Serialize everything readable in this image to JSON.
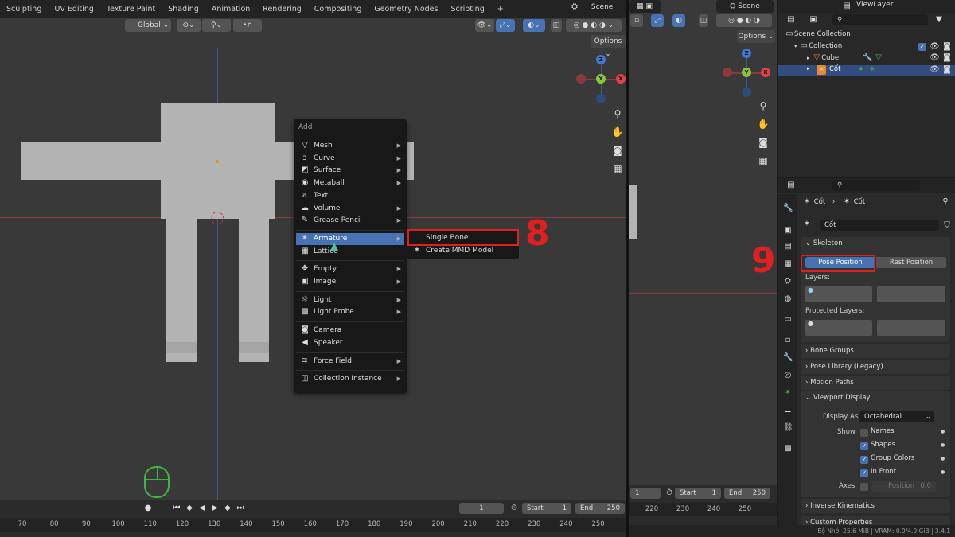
{
  "workspace_tabs": [
    "Sculpting",
    "UV Editing",
    "Texture Paint",
    "Shading",
    "Animation",
    "Rendering",
    "Compositing",
    "Geometry Nodes",
    "Scripting",
    "+"
  ],
  "scene_name": "Scene",
  "view_layer": "ViewLayer",
  "transform_orientation": "Global",
  "options_label": "Options",
  "add_menu": {
    "title": "Add",
    "items": [
      {
        "label": "Mesh",
        "icon": "mesh-icon",
        "glyph": "▽",
        "has_sub": true
      },
      {
        "label": "Curve",
        "icon": "curve-icon",
        "glyph": "ↄ",
        "has_sub": true
      },
      {
        "label": "Surface",
        "icon": "surface-icon",
        "glyph": "◩",
        "has_sub": true
      },
      {
        "label": "Metaball",
        "icon": "metaball-icon",
        "glyph": "◉",
        "has_sub": true
      },
      {
        "label": "Text",
        "icon": "text-icon",
        "glyph": "a",
        "has_sub": false
      },
      {
        "label": "Volume",
        "icon": "volume-icon",
        "glyph": "☁",
        "has_sub": true
      },
      {
        "label": "Grease Pencil",
        "icon": "grease-pencil-icon",
        "glyph": "✎",
        "has_sub": true
      },
      {
        "label": "Armature",
        "icon": "armature-icon",
        "glyph": "✶",
        "has_sub": true,
        "active": true
      },
      {
        "label": "Lattice",
        "icon": "lattice-icon",
        "glyph": "▦",
        "has_sub": false
      },
      {
        "label": "Empty",
        "icon": "empty-icon",
        "glyph": "✥",
        "has_sub": true
      },
      {
        "label": "Image",
        "icon": "image-icon",
        "glyph": "▣",
        "has_sub": true
      },
      {
        "label": "Light",
        "icon": "light-icon",
        "glyph": "☼",
        "has_sub": true
      },
      {
        "label": "Light Probe",
        "icon": "light-probe-icon",
        "glyph": "▩",
        "has_sub": true
      },
      {
        "label": "Camera",
        "icon": "camera-icon",
        "glyph": "◙",
        "has_sub": false
      },
      {
        "label": "Speaker",
        "icon": "speaker-icon",
        "glyph": "◀",
        "has_sub": false
      },
      {
        "label": "Force Field",
        "icon": "force-field-icon",
        "glyph": "≋",
        "has_sub": true
      },
      {
        "label": "Collection Instance",
        "icon": "collection-instance-icon",
        "glyph": "◫",
        "has_sub": true
      }
    ]
  },
  "armature_submenu": [
    "Single Bone",
    "Create MMD Model"
  ],
  "step_labels": {
    "left": "8",
    "right": "9"
  },
  "timeline": {
    "current_frame": "1",
    "start_label": "Start",
    "start": "1",
    "end_label": "End",
    "end": "250",
    "ruler": [
      "70",
      "80",
      "90",
      "100",
      "110",
      "120",
      "130",
      "140",
      "150",
      "160",
      "170",
      "180",
      "190",
      "200",
      "210",
      "220",
      "230",
      "240",
      "250"
    ],
    "ruler_right": [
      "220",
      "230",
      "240",
      "250"
    ]
  },
  "outliner": {
    "scene_collection": "Scene Collection",
    "collection": "Collection",
    "objects": [
      "Cube",
      "Cốt"
    ]
  },
  "properties": {
    "breadcrumb_object": "Cốt",
    "breadcrumb_data": "Cốt",
    "data_name": "Cốt",
    "skeleton_label": "Skeleton",
    "pose_position": "Pose Position",
    "rest_position": "Rest Position",
    "layers_label": "Layers:",
    "protected_layers_label": "Protected Layers:",
    "panels": [
      "Bone Groups",
      "Pose Library (Legacy)",
      "Motion Paths"
    ],
    "viewport_display": "Viewport Display",
    "display_as_label": "Display As",
    "display_as_value": "Octahedral",
    "show_label": "Show",
    "show_options": [
      {
        "label": "Names",
        "checked": false
      },
      {
        "label": "Shapes",
        "checked": true
      },
      {
        "label": "Group Colors",
        "checked": true
      },
      {
        "label": "In Front",
        "checked": true
      }
    ],
    "axes_label": "Axes",
    "position_label": "Position",
    "position_value": "0.0",
    "panels_bottom": [
      "Inverse Kinematics",
      "Custom Properties"
    ]
  },
  "status_bar": "Bộ Nhớ: 25.6 MiB | VRAM: 0.9/4.0 GiB | 3.4.1",
  "colors": {
    "accent": "#4772b3",
    "highlight": "#e01f1f"
  }
}
